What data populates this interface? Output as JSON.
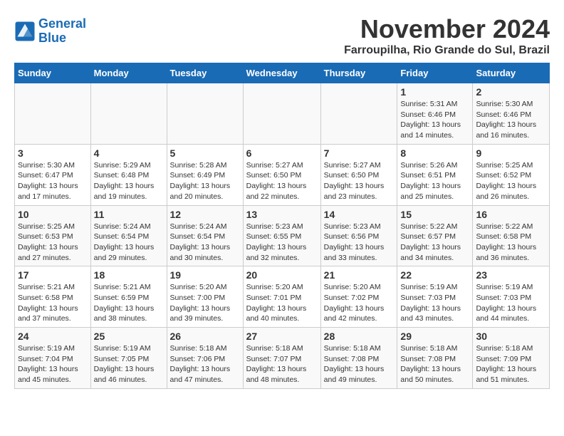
{
  "header": {
    "logo_line1": "General",
    "logo_line2": "Blue",
    "month": "November 2024",
    "location": "Farroupilha, Rio Grande do Sul, Brazil"
  },
  "weekdays": [
    "Sunday",
    "Monday",
    "Tuesday",
    "Wednesday",
    "Thursday",
    "Friday",
    "Saturday"
  ],
  "weeks": [
    {
      "days": [
        {
          "date": "",
          "info": ""
        },
        {
          "date": "",
          "info": ""
        },
        {
          "date": "",
          "info": ""
        },
        {
          "date": "",
          "info": ""
        },
        {
          "date": "",
          "info": ""
        },
        {
          "date": "1",
          "info": "Sunrise: 5:31 AM\nSunset: 6:46 PM\nDaylight: 13 hours\nand 14 minutes."
        },
        {
          "date": "2",
          "info": "Sunrise: 5:30 AM\nSunset: 6:46 PM\nDaylight: 13 hours\nand 16 minutes."
        }
      ]
    },
    {
      "days": [
        {
          "date": "3",
          "info": "Sunrise: 5:30 AM\nSunset: 6:47 PM\nDaylight: 13 hours\nand 17 minutes."
        },
        {
          "date": "4",
          "info": "Sunrise: 5:29 AM\nSunset: 6:48 PM\nDaylight: 13 hours\nand 19 minutes."
        },
        {
          "date": "5",
          "info": "Sunrise: 5:28 AM\nSunset: 6:49 PM\nDaylight: 13 hours\nand 20 minutes."
        },
        {
          "date": "6",
          "info": "Sunrise: 5:27 AM\nSunset: 6:50 PM\nDaylight: 13 hours\nand 22 minutes."
        },
        {
          "date": "7",
          "info": "Sunrise: 5:27 AM\nSunset: 6:50 PM\nDaylight: 13 hours\nand 23 minutes."
        },
        {
          "date": "8",
          "info": "Sunrise: 5:26 AM\nSunset: 6:51 PM\nDaylight: 13 hours\nand 25 minutes."
        },
        {
          "date": "9",
          "info": "Sunrise: 5:25 AM\nSunset: 6:52 PM\nDaylight: 13 hours\nand 26 minutes."
        }
      ]
    },
    {
      "days": [
        {
          "date": "10",
          "info": "Sunrise: 5:25 AM\nSunset: 6:53 PM\nDaylight: 13 hours\nand 27 minutes."
        },
        {
          "date": "11",
          "info": "Sunrise: 5:24 AM\nSunset: 6:54 PM\nDaylight: 13 hours\nand 29 minutes."
        },
        {
          "date": "12",
          "info": "Sunrise: 5:24 AM\nSunset: 6:54 PM\nDaylight: 13 hours\nand 30 minutes."
        },
        {
          "date": "13",
          "info": "Sunrise: 5:23 AM\nSunset: 6:55 PM\nDaylight: 13 hours\nand 32 minutes."
        },
        {
          "date": "14",
          "info": "Sunrise: 5:23 AM\nSunset: 6:56 PM\nDaylight: 13 hours\nand 33 minutes."
        },
        {
          "date": "15",
          "info": "Sunrise: 5:22 AM\nSunset: 6:57 PM\nDaylight: 13 hours\nand 34 minutes."
        },
        {
          "date": "16",
          "info": "Sunrise: 5:22 AM\nSunset: 6:58 PM\nDaylight: 13 hours\nand 36 minutes."
        }
      ]
    },
    {
      "days": [
        {
          "date": "17",
          "info": "Sunrise: 5:21 AM\nSunset: 6:58 PM\nDaylight: 13 hours\nand 37 minutes."
        },
        {
          "date": "18",
          "info": "Sunrise: 5:21 AM\nSunset: 6:59 PM\nDaylight: 13 hours\nand 38 minutes."
        },
        {
          "date": "19",
          "info": "Sunrise: 5:20 AM\nSunset: 7:00 PM\nDaylight: 13 hours\nand 39 minutes."
        },
        {
          "date": "20",
          "info": "Sunrise: 5:20 AM\nSunset: 7:01 PM\nDaylight: 13 hours\nand 40 minutes."
        },
        {
          "date": "21",
          "info": "Sunrise: 5:20 AM\nSunset: 7:02 PM\nDaylight: 13 hours\nand 42 minutes."
        },
        {
          "date": "22",
          "info": "Sunrise: 5:19 AM\nSunset: 7:03 PM\nDaylight: 13 hours\nand 43 minutes."
        },
        {
          "date": "23",
          "info": "Sunrise: 5:19 AM\nSunset: 7:03 PM\nDaylight: 13 hours\nand 44 minutes."
        }
      ]
    },
    {
      "days": [
        {
          "date": "24",
          "info": "Sunrise: 5:19 AM\nSunset: 7:04 PM\nDaylight: 13 hours\nand 45 minutes."
        },
        {
          "date": "25",
          "info": "Sunrise: 5:19 AM\nSunset: 7:05 PM\nDaylight: 13 hours\nand 46 minutes."
        },
        {
          "date": "26",
          "info": "Sunrise: 5:18 AM\nSunset: 7:06 PM\nDaylight: 13 hours\nand 47 minutes."
        },
        {
          "date": "27",
          "info": "Sunrise: 5:18 AM\nSunset: 7:07 PM\nDaylight: 13 hours\nand 48 minutes."
        },
        {
          "date": "28",
          "info": "Sunrise: 5:18 AM\nSunset: 7:08 PM\nDaylight: 13 hours\nand 49 minutes."
        },
        {
          "date": "29",
          "info": "Sunrise: 5:18 AM\nSunset: 7:08 PM\nDaylight: 13 hours\nand 50 minutes."
        },
        {
          "date": "30",
          "info": "Sunrise: 5:18 AM\nSunset: 7:09 PM\nDaylight: 13 hours\nand 51 minutes."
        }
      ]
    }
  ]
}
